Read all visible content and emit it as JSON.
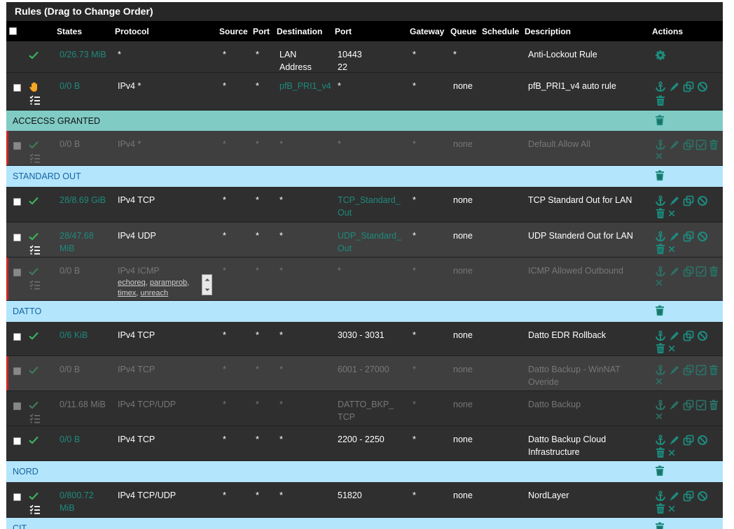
{
  "panel": {
    "title": "Rules (Drag to Change Order)"
  },
  "columns": {
    "states": "States",
    "protocol": "Protocol",
    "source": "Source",
    "port": "Port",
    "destination": "Destination",
    "dport": "Port",
    "gateway": "Gateway",
    "queue": "Queue",
    "schedule": "Schedule",
    "description": "Description",
    "actions": "Actions"
  },
  "colors": {
    "accent": "#1e8a7d",
    "teal_sep": "#80cbc4",
    "blue_sep": "#b3e5fc",
    "disabled_bar": "#c62828"
  },
  "rows": [
    {
      "kind": "rule",
      "states": "0/26.73 MiB",
      "protocol": "*",
      "source": "*",
      "sport": "*",
      "destination": "LAN",
      "destination2": "Address",
      "dport": "10443",
      "dport2": "22",
      "gateway": "*",
      "queue": "*",
      "description": "Anti-Lockout Rule"
    },
    {
      "kind": "rule",
      "states": "0/0 B",
      "protocol": "IPv4 *",
      "source": "*",
      "sport": "*",
      "destination": "pfB_PRI1_v4",
      "dport": "*",
      "gateway": "*",
      "queue": "none",
      "description": "pfB_PRI1_v4 auto rule"
    },
    {
      "kind": "separator",
      "label": "ACCECSS GRANTED"
    },
    {
      "kind": "rule",
      "states": "0/0 B",
      "protocol": "IPv4 *",
      "source": "*",
      "sport": "*",
      "destination": "*",
      "dport": "*",
      "gateway": "*",
      "queue": "none",
      "description": "Default Allow All"
    },
    {
      "kind": "separator",
      "label": "STANDARD OUT"
    },
    {
      "kind": "rule",
      "states": "28/8.69 GiB",
      "protocol": "IPv4 TCP",
      "source": "*",
      "sport": "*",
      "destination": "*",
      "dport": "TCP_Standard_",
      "dport2": "Out",
      "gateway": "*",
      "queue": "none",
      "description": "TCP Standard Out for LAN"
    },
    {
      "kind": "rule",
      "states": "28/47.68",
      "states2": "MiB",
      "protocol": "IPv4 UDP",
      "source": "*",
      "sport": "*",
      "destination": "*",
      "dport": "UDP_Standard_",
      "dport2": "Out",
      "gateway": "*",
      "queue": "none",
      "description": "UDP Standerd Out for LAN"
    },
    {
      "kind": "rule",
      "states": "0/0 B",
      "protocol": "IPv4 ICMP",
      "icmp_types": [
        "echoreq",
        "paramprob",
        "timex",
        "unreach"
      ],
      "source": "*",
      "sport": "*",
      "destination": "*",
      "dport": "*",
      "gateway": "*",
      "queue": "none",
      "description": "ICMP Allowed Outbound"
    },
    {
      "kind": "separator",
      "label": "DATTO"
    },
    {
      "kind": "rule",
      "states": "0/6 KiB",
      "protocol": "IPv4 TCP",
      "source": "*",
      "sport": "*",
      "destination": "*",
      "dport": "3030 - 3031",
      "gateway": "*",
      "queue": "none",
      "description": "Datto EDR Rollback"
    },
    {
      "kind": "rule",
      "states": "0/0 B",
      "protocol": "IPv4 TCP",
      "source": "*",
      "sport": "*",
      "destination": "*",
      "dport": "6001 - 27000",
      "gateway": "*",
      "queue": "none",
      "description": "Datto Backup - WinNAT",
      "description2": "Overide"
    },
    {
      "kind": "rule",
      "states": "0/11.68 MiB",
      "protocol": "IPv4 TCP/UDP",
      "source": "*",
      "sport": "*",
      "destination": "*",
      "dport": "DATTO_BKP_",
      "dport2": "TCP",
      "gateway": "*",
      "queue": "none",
      "description": "Datto Backup"
    },
    {
      "kind": "rule",
      "states": "0/0 B",
      "protocol": "IPv4 TCP",
      "source": "*",
      "sport": "*",
      "destination": "*",
      "dport": "2200 - 2250",
      "gateway": "*",
      "queue": "none",
      "description": "Datto Backup Cloud",
      "description2": "Infrastructure"
    },
    {
      "kind": "separator",
      "label": "NORD"
    },
    {
      "kind": "rule",
      "states": "0/800.72",
      "states2": "MiB",
      "protocol": "IPv4 TCP/UDP",
      "source": "*",
      "sport": "*",
      "destination": "*",
      "dport": "51820",
      "gateway": "*",
      "queue": "none",
      "description": "NordLayer"
    },
    {
      "kind": "separator",
      "label": "CIT"
    }
  ]
}
